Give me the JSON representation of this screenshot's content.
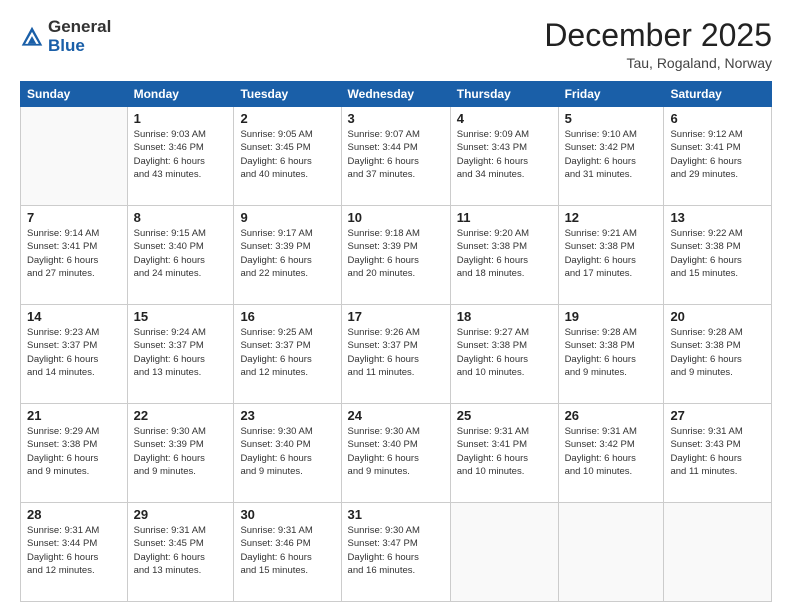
{
  "header": {
    "logo_line1": "General",
    "logo_line2": "Blue",
    "title": "December 2025",
    "subtitle": "Tau, Rogaland, Norway"
  },
  "calendar": {
    "headers": [
      "Sunday",
      "Monday",
      "Tuesday",
      "Wednesday",
      "Thursday",
      "Friday",
      "Saturday"
    ],
    "weeks": [
      [
        {
          "day": "",
          "info": ""
        },
        {
          "day": "1",
          "info": "Sunrise: 9:03 AM\nSunset: 3:46 PM\nDaylight: 6 hours\nand 43 minutes."
        },
        {
          "day": "2",
          "info": "Sunrise: 9:05 AM\nSunset: 3:45 PM\nDaylight: 6 hours\nand 40 minutes."
        },
        {
          "day": "3",
          "info": "Sunrise: 9:07 AM\nSunset: 3:44 PM\nDaylight: 6 hours\nand 37 minutes."
        },
        {
          "day": "4",
          "info": "Sunrise: 9:09 AM\nSunset: 3:43 PM\nDaylight: 6 hours\nand 34 minutes."
        },
        {
          "day": "5",
          "info": "Sunrise: 9:10 AM\nSunset: 3:42 PM\nDaylight: 6 hours\nand 31 minutes."
        },
        {
          "day": "6",
          "info": "Sunrise: 9:12 AM\nSunset: 3:41 PM\nDaylight: 6 hours\nand 29 minutes."
        }
      ],
      [
        {
          "day": "7",
          "info": "Sunrise: 9:14 AM\nSunset: 3:41 PM\nDaylight: 6 hours\nand 27 minutes."
        },
        {
          "day": "8",
          "info": "Sunrise: 9:15 AM\nSunset: 3:40 PM\nDaylight: 6 hours\nand 24 minutes."
        },
        {
          "day": "9",
          "info": "Sunrise: 9:17 AM\nSunset: 3:39 PM\nDaylight: 6 hours\nand 22 minutes."
        },
        {
          "day": "10",
          "info": "Sunrise: 9:18 AM\nSunset: 3:39 PM\nDaylight: 6 hours\nand 20 minutes."
        },
        {
          "day": "11",
          "info": "Sunrise: 9:20 AM\nSunset: 3:38 PM\nDaylight: 6 hours\nand 18 minutes."
        },
        {
          "day": "12",
          "info": "Sunrise: 9:21 AM\nSunset: 3:38 PM\nDaylight: 6 hours\nand 17 minutes."
        },
        {
          "day": "13",
          "info": "Sunrise: 9:22 AM\nSunset: 3:38 PM\nDaylight: 6 hours\nand 15 minutes."
        }
      ],
      [
        {
          "day": "14",
          "info": "Sunrise: 9:23 AM\nSunset: 3:37 PM\nDaylight: 6 hours\nand 14 minutes."
        },
        {
          "day": "15",
          "info": "Sunrise: 9:24 AM\nSunset: 3:37 PM\nDaylight: 6 hours\nand 13 minutes."
        },
        {
          "day": "16",
          "info": "Sunrise: 9:25 AM\nSunset: 3:37 PM\nDaylight: 6 hours\nand 12 minutes."
        },
        {
          "day": "17",
          "info": "Sunrise: 9:26 AM\nSunset: 3:37 PM\nDaylight: 6 hours\nand 11 minutes."
        },
        {
          "day": "18",
          "info": "Sunrise: 9:27 AM\nSunset: 3:38 PM\nDaylight: 6 hours\nand 10 minutes."
        },
        {
          "day": "19",
          "info": "Sunrise: 9:28 AM\nSunset: 3:38 PM\nDaylight: 6 hours\nand 9 minutes."
        },
        {
          "day": "20",
          "info": "Sunrise: 9:28 AM\nSunset: 3:38 PM\nDaylight: 6 hours\nand 9 minutes."
        }
      ],
      [
        {
          "day": "21",
          "info": "Sunrise: 9:29 AM\nSunset: 3:38 PM\nDaylight: 6 hours\nand 9 minutes."
        },
        {
          "day": "22",
          "info": "Sunrise: 9:30 AM\nSunset: 3:39 PM\nDaylight: 6 hours\nand 9 minutes."
        },
        {
          "day": "23",
          "info": "Sunrise: 9:30 AM\nSunset: 3:40 PM\nDaylight: 6 hours\nand 9 minutes."
        },
        {
          "day": "24",
          "info": "Sunrise: 9:30 AM\nSunset: 3:40 PM\nDaylight: 6 hours\nand 9 minutes."
        },
        {
          "day": "25",
          "info": "Sunrise: 9:31 AM\nSunset: 3:41 PM\nDaylight: 6 hours\nand 10 minutes."
        },
        {
          "day": "26",
          "info": "Sunrise: 9:31 AM\nSunset: 3:42 PM\nDaylight: 6 hours\nand 10 minutes."
        },
        {
          "day": "27",
          "info": "Sunrise: 9:31 AM\nSunset: 3:43 PM\nDaylight: 6 hours\nand 11 minutes."
        }
      ],
      [
        {
          "day": "28",
          "info": "Sunrise: 9:31 AM\nSunset: 3:44 PM\nDaylight: 6 hours\nand 12 minutes."
        },
        {
          "day": "29",
          "info": "Sunrise: 9:31 AM\nSunset: 3:45 PM\nDaylight: 6 hours\nand 13 minutes."
        },
        {
          "day": "30",
          "info": "Sunrise: 9:31 AM\nSunset: 3:46 PM\nDaylight: 6 hours\nand 15 minutes."
        },
        {
          "day": "31",
          "info": "Sunrise: 9:30 AM\nSunset: 3:47 PM\nDaylight: 6 hours\nand 16 minutes."
        },
        {
          "day": "",
          "info": ""
        },
        {
          "day": "",
          "info": ""
        },
        {
          "day": "",
          "info": ""
        }
      ]
    ]
  }
}
